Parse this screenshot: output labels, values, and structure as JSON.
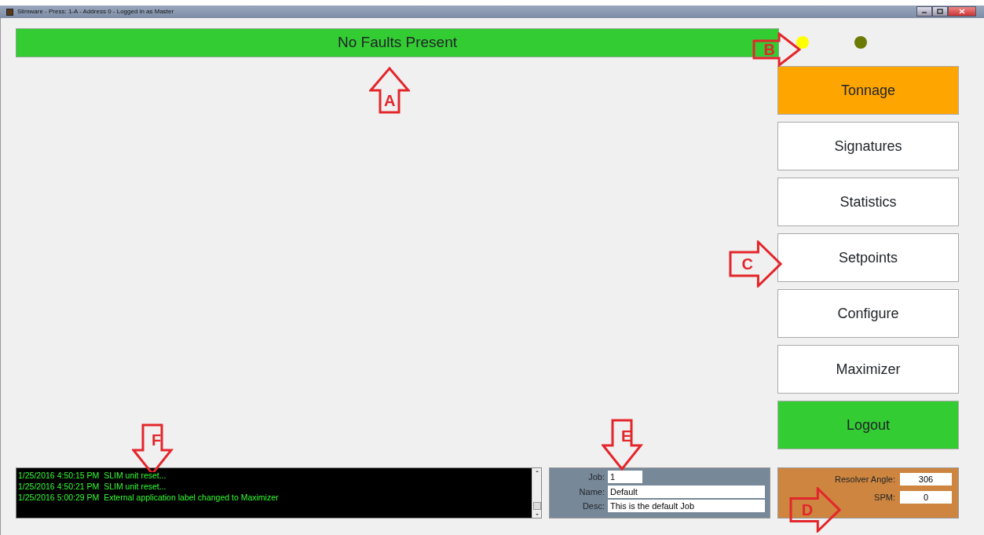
{
  "window": {
    "title": "Slimware - Press: 1-A - Address 0 - Logged in as Master"
  },
  "fault_bar": {
    "text": "No Faults Present"
  },
  "indicators": [
    {
      "color": "#ffff00"
    },
    {
      "color": "#6b7a00"
    }
  ],
  "menu": [
    {
      "label": "Tonnage",
      "kind": "nav",
      "selected": true
    },
    {
      "label": "Signatures",
      "kind": "nav",
      "selected": false
    },
    {
      "label": "Statistics",
      "kind": "nav",
      "selected": false
    },
    {
      "label": "Setpoints",
      "kind": "nav",
      "selected": false
    },
    {
      "label": "Configure",
      "kind": "nav",
      "selected": false
    },
    {
      "label": "Maximizer",
      "kind": "nav",
      "selected": false
    },
    {
      "label": "Logout",
      "kind": "logout",
      "selected": false
    }
  ],
  "log": [
    "1/25/2016 4:50:15 PM  SLIM unit reset...",
    "1/25/2016 4:50:21 PM  SLIM unit reset...",
    "1/25/2016 5:00:29 PM  External application label changed to Maximizer"
  ],
  "job": [
    {
      "label": "Job:",
      "value": "1",
      "kind": "short"
    },
    {
      "label": "Name:",
      "value": "Default",
      "kind": "long"
    },
    {
      "label": "Desc:",
      "value": "This is the default Job",
      "kind": "long"
    }
  ],
  "press": [
    {
      "label": "Resolver Angle:",
      "value": "306"
    },
    {
      "label": "SPM:",
      "value": "0"
    }
  ],
  "callouts": [
    {
      "label": "A",
      "kind": "up"
    },
    {
      "label": "B",
      "kind": "right"
    },
    {
      "label": "C",
      "kind": "right"
    },
    {
      "label": "D",
      "kind": "right"
    },
    {
      "label": "E",
      "kind": "down"
    },
    {
      "label": "F",
      "kind": "down"
    }
  ]
}
